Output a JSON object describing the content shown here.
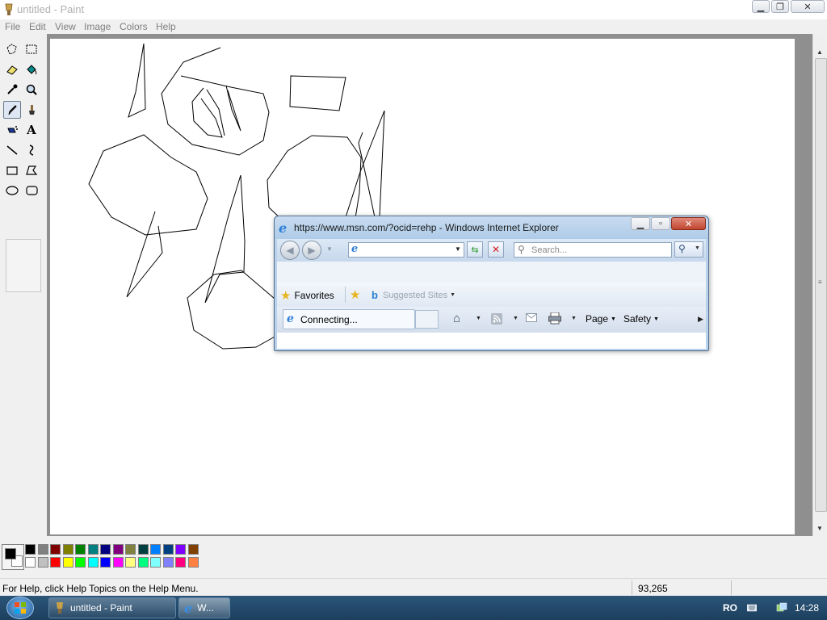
{
  "paint": {
    "title": "untitled - Paint",
    "menu": [
      "File",
      "Edit",
      "View",
      "Image",
      "Colors",
      "Help"
    ],
    "tools": [
      "free-form-select",
      "select",
      "eraser",
      "fill-with-color",
      "pick-color",
      "magnifier",
      "pencil",
      "brush",
      "airbrush",
      "text",
      "line",
      "curve",
      "rectangle",
      "polygon",
      "ellipse",
      "rounded-rectangle"
    ],
    "selected_tool": "pencil",
    "status_help": "For Help, click Help Topics on the Help Menu.",
    "status_coords": "93,265",
    "foreground_color": "#000000",
    "background_color": "#ffffff",
    "palette_top": [
      "#000000",
      "#808080",
      "#800000",
      "#808000",
      "#008000",
      "#008080",
      "#000080",
      "#800080",
      "#808040",
      "#004040",
      "#0080ff",
      "#004080",
      "#8000ff",
      "#804000"
    ],
    "palette_bottom": [
      "#ffffff",
      "#c0c0c0",
      "#ff0000",
      "#ffff00",
      "#00ff00",
      "#00ffff",
      "#0000ff",
      "#ff00ff",
      "#ffff80",
      "#00ff80",
      "#80ffff",
      "#8080ff",
      "#ff0080",
      "#ff8040"
    ]
  },
  "ie": {
    "title": "https://www.msn.com/?ocid=rehp - Windows Internet Explorer",
    "search_placeholder": "Search...",
    "favorites_label": "Favorites",
    "suggested_sites_label": "Suggested Sites",
    "tab_label": "Connecting...",
    "page_label": "Page",
    "safety_label": "Safety"
  },
  "taskbar": {
    "paint_button": "untitled - Paint",
    "ie_button": "W...",
    "language": "RO",
    "clock": "14:28"
  }
}
